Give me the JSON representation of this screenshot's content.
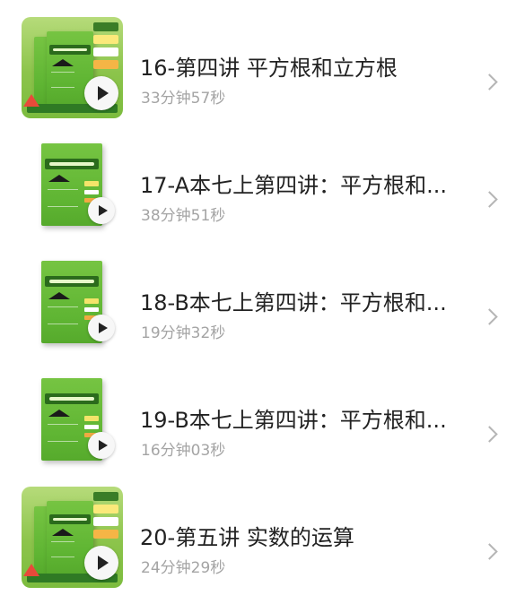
{
  "lessons": [
    {
      "title": "16-第四讲 平方根和立方根",
      "duration": "33分钟57秒",
      "thumbnail_style": "wide",
      "icon": "play-icon"
    },
    {
      "title": "17-A本七上第四讲：平方根和...",
      "duration": "38分钟51秒",
      "thumbnail_style": "single",
      "icon": "play-icon"
    },
    {
      "title": "18-B本七上第四讲：平方根和...",
      "duration": "19分钟32秒",
      "thumbnail_style": "single",
      "icon": "play-icon"
    },
    {
      "title": "19-B本七上第四讲：平方根和...",
      "duration": "16分钟03秒",
      "thumbnail_style": "single",
      "icon": "play-icon"
    },
    {
      "title": "20-第五讲 实数的运算",
      "duration": "24分钟29秒",
      "thumbnail_style": "wide",
      "icon": "play-icon"
    }
  ],
  "colors": {
    "title_text": "#222222",
    "duration_text": "#a4a4a4",
    "chevron": "#b5b5b5",
    "cover_green": "#5fb533"
  }
}
